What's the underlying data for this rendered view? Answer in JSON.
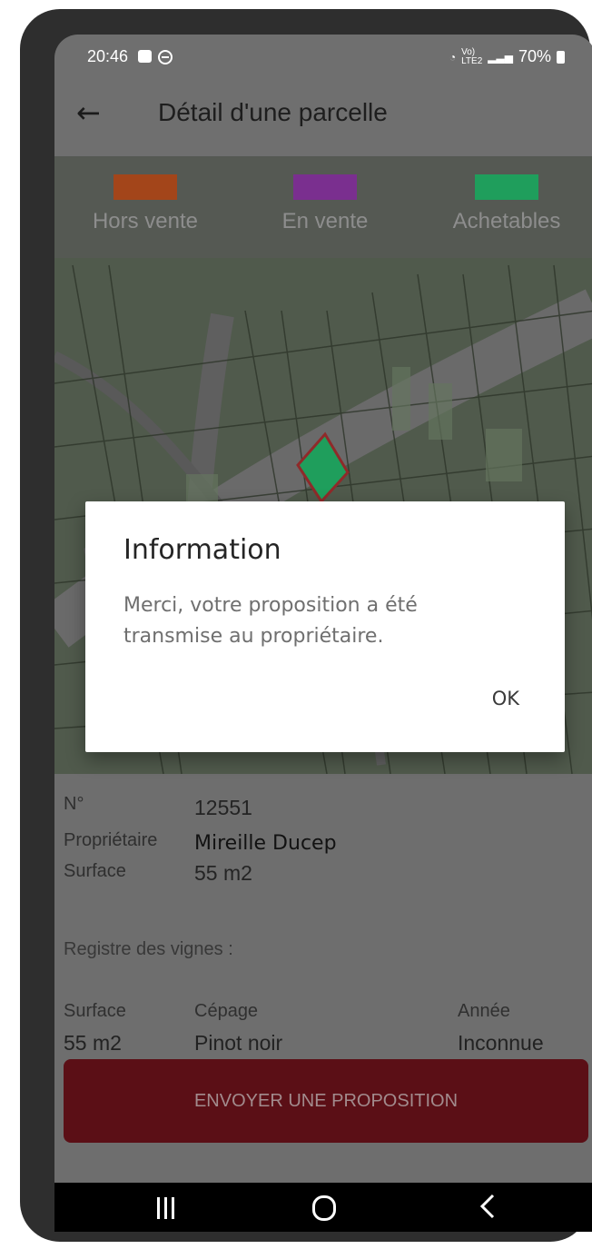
{
  "status_bar": {
    "time": "20:46",
    "network": "Vo)\nLTE2",
    "battery": "70%"
  },
  "app_bar": {
    "title": "Détail d'une parcelle"
  },
  "legend": [
    {
      "label": "Hors vente",
      "color": "#a3451a"
    },
    {
      "label": "En vente",
      "color": "#7a2f8f"
    },
    {
      "label": "Achetables",
      "color": "#1f9e5c"
    }
  ],
  "parcel": {
    "labels": {
      "number": "N°",
      "owner": "Propriétaire",
      "surface": "Surface"
    },
    "number": "12551",
    "owner": "Mireille Ducep",
    "surface": "55 m2"
  },
  "vine_registry": {
    "title": "Registre des vignes :",
    "headers": {
      "surface": "Surface",
      "variety": "Cépage",
      "year": "Année"
    },
    "row": {
      "surface": "55 m2",
      "variety": "Pinot noir",
      "year": "Inconnue"
    }
  },
  "actions": {
    "send_proposal": "ENVOYER UNE PROPOSITION"
  },
  "dialog": {
    "title": "Information",
    "message": "Merci, votre proposition a été transmise au propriétaire.",
    "ok_label": "OK"
  },
  "icons": {
    "back": "arrow-left-icon",
    "wifi": "wifi-icon",
    "signal": "signal-icon",
    "battery": "battery-icon"
  }
}
